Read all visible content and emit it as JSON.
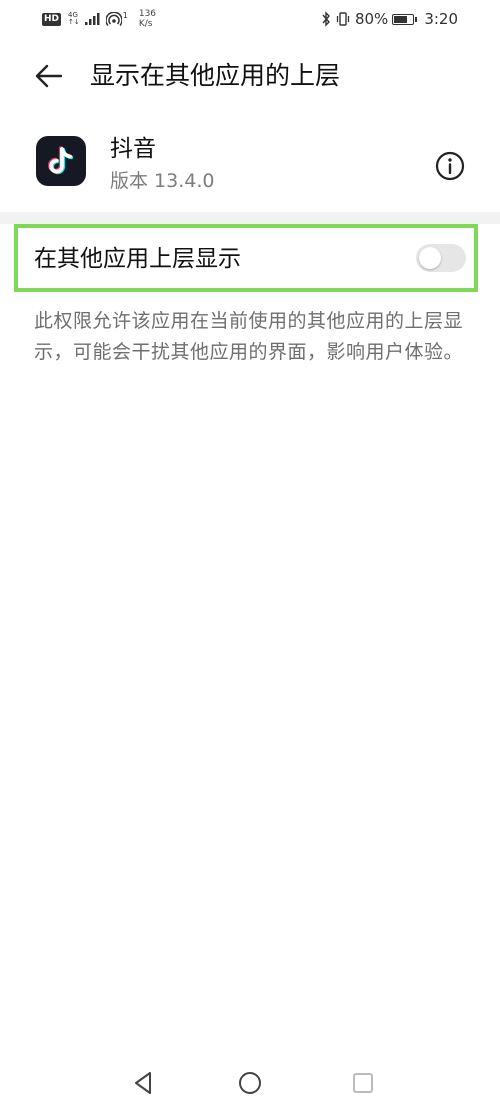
{
  "status_bar": {
    "hd": "HD",
    "network_top": "4G",
    "network_bottom": "↑↓",
    "wifi_sup": "1",
    "speed_value": "136",
    "speed_unit": "K/s",
    "battery_percent": "80%",
    "battery_level": 0.8,
    "time": "3:20"
  },
  "header": {
    "title": "显示在其他应用的上层"
  },
  "app": {
    "name": "抖音",
    "version": "版本 13.4.0",
    "icon": "tiktok-logo"
  },
  "permission": {
    "label": "在其他应用上层显示",
    "enabled": false,
    "highlight_color": "#7ed957",
    "description": "此权限允许该应用在当前使用的其他应用的上层显示，可能会干扰其他应用的界面，影响用户体验。"
  },
  "nav_bar": {
    "icons": [
      "back-triangle-icon",
      "home-circle-icon",
      "recent-square-icon"
    ]
  }
}
